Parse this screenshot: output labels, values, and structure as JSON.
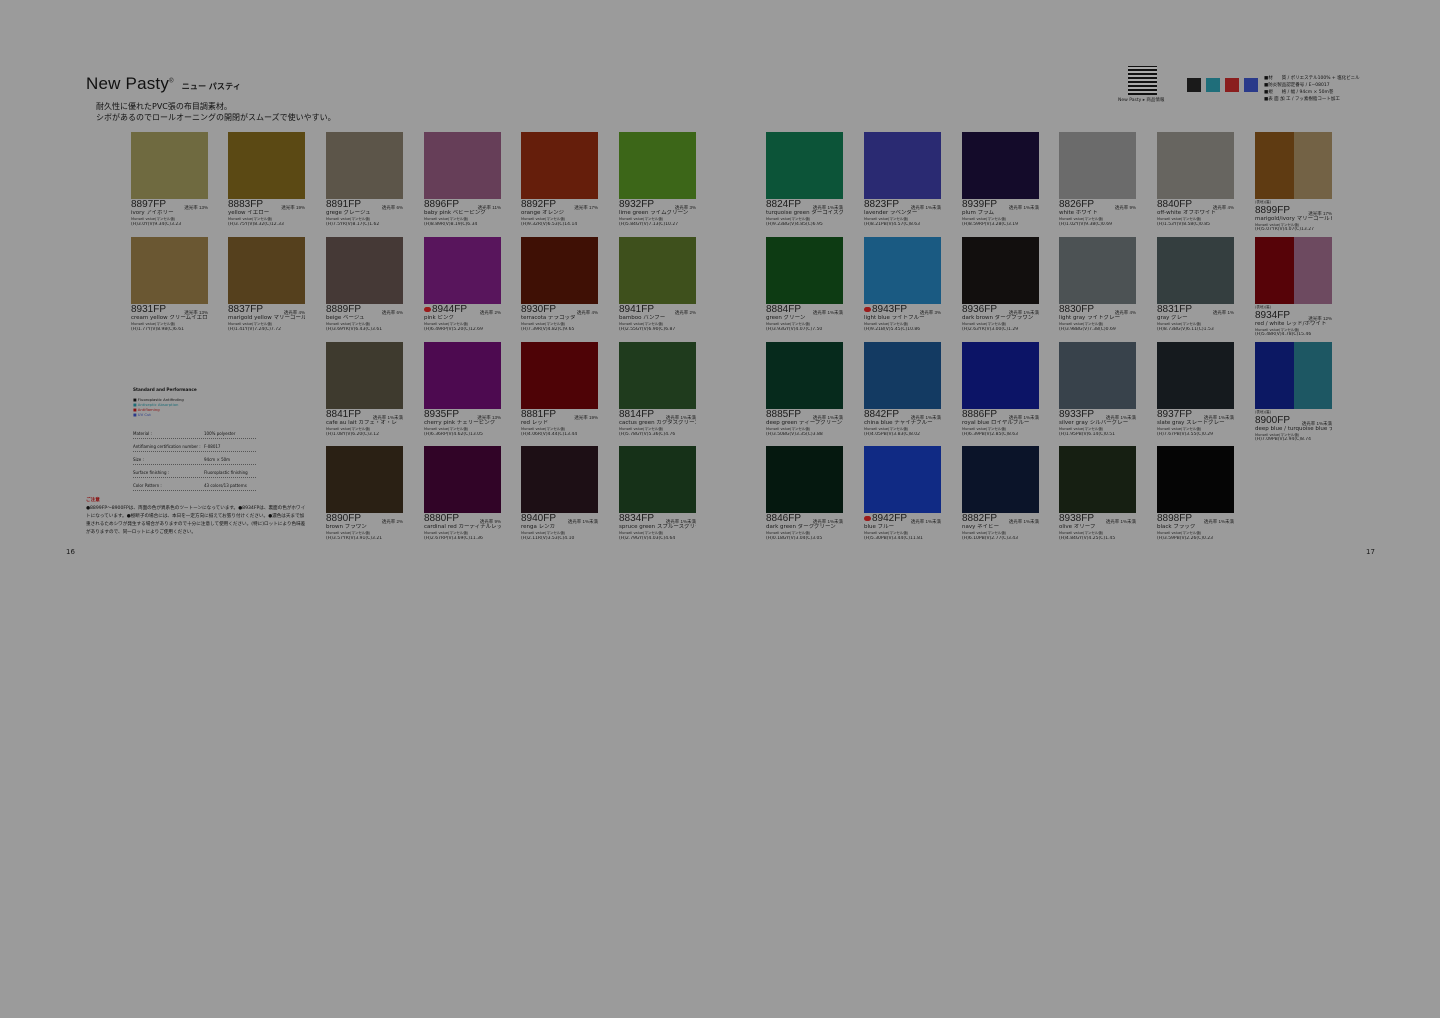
{
  "header": {
    "title": "New Pasty",
    "title_reg": "®",
    "title_ja": "ニュー パスティ",
    "tagline1": "耐久性に優れたPVC張の布目調素材。",
    "tagline2": "シボがあるのでロールオーニングの開閉がスムーズで使いやすい。"
  },
  "top_right": {
    "qr_label": "New Pasty ▸ 商品情報",
    "cert_colors": [
      "#1a1a1a",
      "#1f6e7a",
      "#8a1e1e",
      "#2a3a8a"
    ],
    "spec_lines": [
      "■材　　質 / ポリエステル100% + 塩化ビニル",
      "■防炎製品認定番号 / E−08017",
      "■規　　格 / 幅 / 94cm × 50m巻",
      "■表 面 加 工 / フッ素樹脂コート加工"
    ]
  },
  "page_numbers": {
    "left": "16",
    "right": "17"
  },
  "spec_box": {
    "title": "Standard and Performance",
    "legend": [
      "■ Fluoroplastic Antifinding",
      "■ Antiseptic Absorption",
      "■ Antiflaming",
      "■ UV Cut"
    ],
    "legend_colors": [
      "#111111",
      "#1e6e78",
      "#8b1010",
      "#2a3a8a"
    ],
    "rows": [
      {
        "k": "Material :",
        "v": "100% polyester"
      },
      {
        "k": "Antiflaming certification number :",
        "v": "F-08017"
      },
      {
        "k": "Size :",
        "v": "94cm × 50m"
      },
      {
        "k": "Surface finishing :",
        "v": "Fluoroplastic finishing"
      },
      {
        "k": "Color Pattern :",
        "v": "43 colors/13 patterns"
      }
    ]
  },
  "note": {
    "heading": "ご注意",
    "text": "●8899FP〜8900FPは、両面の色が異系色のツートーンになっています。●8934FPは、裏面の色がホワイトになっています。●極断子の場合には、本日を一定方向に揃えてお張り付けください。●濃色は天まで加重されるためシワが発生する場合がありますので十分に注意して使用ください。(特に)ロットにより色味差がありますので、同一ロットによりご使用ください。"
  },
  "mark_label": "Munsell value(マンセル値)",
  "swatches": [
    {
      "code": "8897FP",
      "rate": "透光率 13%",
      "name": "ivory",
      "ja": "アイボリー",
      "val": "(H)3.0Y(V)9.34(C)3.23",
      "color": "#6f6a40"
    },
    {
      "code": "8883FP",
      "rate": "透光率 19%",
      "name": "yellow",
      "ja": "イエロー",
      "val": "(H)3.75Y(V)8.32(C)12.33",
      "color": "#5b4914"
    },
    {
      "code": "8891FP",
      "rate": "透光率 6%",
      "name": "grege",
      "ja": "グレージュ",
      "val": "(H)7.5YR(V)8.17(C)1.62",
      "color": "#5c5549"
    },
    {
      "code": "8896FP",
      "rate": "透光率 11%",
      "name": "baby pink",
      "ja": "ベビーピンク",
      "val": "(H)8.89R(V)8.19(C)6.34",
      "color": "#663e58"
    },
    {
      "code": "8892FP",
      "rate": "透光率 17%",
      "name": "orange",
      "ja": "オレンジ",
      "val": "(H)9.32R(V)6.53(C)14.14",
      "color": "#651e0b"
    },
    {
      "code": "8932FP",
      "rate": "透光率 3%",
      "name": "lime green",
      "ja": "ライムグリーン",
      "val": "(H)5.84GY(V)7.13(C)10.27",
      "color": "#3c6618"
    },
    {
      "code": "8931FP",
      "rate": "透光率 13%",
      "name": "cream yellow",
      "ja": "クリームイエロー",
      "val": "(H)1.77Y(V)8.98(C)6.61",
      "color": "#6a5732"
    },
    {
      "code": "8837FP",
      "rate": "透光率 4%",
      "name": "marigold yellow",
      "ja": "マリーゴールドイエロー",
      "val": "(H)1.41Y(V)7.24(C)7.72",
      "color": "#55401d"
    },
    {
      "code": "8889FP",
      "rate": "透光率 6%",
      "name": "beige",
      "ja": "ベージュ",
      "val": "(H)3.69YR(V)6.43(C)3.61",
      "color": "#453936"
    },
    {
      "code": "8944FP",
      "rate": "透光率 2%",
      "name": "pink",
      "ja": "ピンク",
      "val": "(H)6.49RP(V)5.20(C)12.69",
      "color": "#58155c",
      "badge": true
    },
    {
      "code": "8930FP",
      "rate": "透光率 4%",
      "name": "terracota",
      "ja": "テラコッタ",
      "val": "(H)7.39R(V)4.82(C)9.65",
      "color": "#3f1005"
    },
    {
      "code": "8941FP",
      "rate": "透光率 2%",
      "name": "bamboo",
      "ja": "バンブー",
      "val": "(H)2.55GY(V)6.90(C)6.87",
      "color": "#3e501c"
    },
    {
      "code": "8841FP",
      "rate": "透光率 1%未満",
      "name": "cafe au lait",
      "ja": "カフェ・オ・レ",
      "val": "(H)1.08Y(V)6.20(C)3.12",
      "color": "#3e3a2e"
    },
    {
      "code": "8935FP",
      "rate": "透光率 13%",
      "name": "cherry pink",
      "ja": "チェリーピンク",
      "val": "(H)6.36RP(V)4.62(C)13.05",
      "color": "#4d0a50"
    },
    {
      "code": "8881FP",
      "rate": "透光率 19%",
      "name": "red",
      "ja": "レッド",
      "val": "(H)4.06R(V)4.44(C)13.44",
      "color": "#4e0306"
    },
    {
      "code": "8814FP",
      "rate": "透光率 1%未満",
      "name": "cactus green",
      "ja": "カクタスグリーン",
      "val": "(H)5.78GY(V)5.36(C)4.76",
      "color": "#1f3b1d"
    },
    {
      "code": "8890FP",
      "rate": "透光率 2%",
      "name": "brown",
      "ja": "ブラウン",
      "val": "(H)3.57YR(V)3.91(C)3.21",
      "color": "#2a2014"
    },
    {
      "code": "8880FP",
      "rate": "透光率 9%",
      "name": "cardinal red",
      "ja": "カーディナルレッド",
      "val": "(H)2.67RP(V)3.69(C)11.36",
      "color": "#310427"
    },
    {
      "code": "8940FP",
      "rate": "透光率 1%未満",
      "name": "renga",
      "ja": "レンガ",
      "val": "(H)2.11R(V)3.53(C)4.10",
      "color": "#1d0f15"
    },
    {
      "code": "8834FP",
      "rate": "透光率 1%未満",
      "name": "spruce green",
      "ja": "スプルースグリーン",
      "val": "(H)2.79GY(V)4.03(C)4.64",
      "color": "#163118"
    },
    {
      "code": "8824FP",
      "rate": "透光率 1%未満",
      "name": "turquoise green",
      "ja": "ターコイズグリーン",
      "val": "(H)9.23BG(V)4.85(C)6.95",
      "color": "#0c5438"
    },
    {
      "code": "8823FP",
      "rate": "透光率 1%未満",
      "name": "lavender",
      "ja": "ラベンダー",
      "val": "(H)8.21PB(V)4.57(C)8.63",
      "color": "#2a2a72"
    },
    {
      "code": "8939FP",
      "rate": "透光率 1%未満",
      "name": "plum",
      "ja": "プラム",
      "val": "(H)8.59RP(V)3.28(C)3.19",
      "color": "#140b2a"
    },
    {
      "code": "8826FP",
      "rate": "透光率 9%",
      "name": "white",
      "ja": "ホワイト",
      "val": "(H)1.02Y(V)9.38(C)0.69",
      "color": "#6b6b6b"
    },
    {
      "code": "8840FP",
      "rate": "透光率 4%",
      "name": "off-white",
      "ja": "オフホワイト",
      "val": "(H)1.53Y(V)8.58(C)0.85",
      "color": "#676560"
    },
    {
      "code": "8899FP",
      "rate": "透光率 17%",
      "name": "marigold/ivory",
      "ja": "マリーゴールド/アイボリー",
      "val": "(H)5.07YR(V)4.07(C)13.27",
      "colors": [
        "#5f3b12",
        "#736245"
      ],
      "pre": "(表地)(裏)"
    },
    {
      "code": "8884FP",
      "rate": "透光率 1%未満",
      "name": "green",
      "ja": "グリーン",
      "val": "(H)3.93GY(V)4.07(C)7.50",
      "color": "#0d3b13"
    },
    {
      "code": "8943FP",
      "rate": "透光率 3%",
      "name": "light blue",
      "ja": "ライトブルー",
      "val": "(H)9.21B(V)5.45(C)10.86",
      "color": "#1a5a82",
      "badge": true
    },
    {
      "code": "8936FP",
      "rate": "透光率 1%未満",
      "name": "dark brown",
      "ja": "ダークブラウン",
      "val": "(H)2.63YR(V)3.00(C)1.29",
      "color": "#120f0e"
    },
    {
      "code": "8830FP",
      "rate": "透光率 4%",
      "name": "light gray",
      "ja": "ライトグレー",
      "val": "(H)3.98BG(V)7.38(C)0.69",
      "color": "#4c5254"
    },
    {
      "code": "8831FP",
      "rate": "透光率 1%",
      "name": "gray",
      "ja": "グレー",
      "val": "(H)8.73BG(V)6.11(C)1.53",
      "color": "#343e3f"
    },
    {
      "code": "8934FP",
      "rate": "透光率 12%",
      "name": "red / white",
      "ja": "レッド/ホワイト",
      "val": "(H)5.48R(V)4.78(C)15.46",
      "colors": [
        "#560308",
        "#6d4a60"
      ],
      "pre": "(表地)(裏)"
    },
    {
      "code": "8885FP",
      "rate": "透光率 1%未満",
      "name": "deep green",
      "ja": "ディープグリーン",
      "val": "(H)3.50BG(V)3.35(C)3.88",
      "color": "#062a1c"
    },
    {
      "code": "8842FP",
      "rate": "透光率 1%未満",
      "name": "china blue",
      "ja": "チャイナブルー",
      "val": "(H)4.05PB(V)3.83(C)8.02",
      "color": "#133a62"
    },
    {
      "code": "8886FP",
      "rate": "透光率 1%未満",
      "name": "royal blue",
      "ja": "ロイヤルブルー",
      "val": "(H)6.39PB(V)2.85(C)8.63",
      "color": "#0c1466"
    },
    {
      "code": "8933FP",
      "rate": "透光率 1%未満",
      "name": "silver gray",
      "ja": "シルバーグレー",
      "val": "(H)1.95PB(V)6.14(C)0.51",
      "color": "#38424b"
    },
    {
      "code": "8937FP",
      "rate": "透光率 1%未満",
      "name": "slate gray",
      "ja": "スレートグレー",
      "val": "(H)7.67PB(V)3.55(C)0.29",
      "color": "#151a1e"
    },
    {
      "code": "8900FP",
      "rate": "透光率 1%未満",
      "name": "deep blue / turquoise blue",
      "ja": "ディープブルー/ターコイズブルー",
      "val": "(H)7.09PB(V)2.94(C)8.74",
      "colors": [
        "#0c1863",
        "#1d5763"
      ],
      "pre": "(表地)(裏)"
    },
    {
      "code": "8846FP",
      "rate": "透光率 1%未満",
      "name": "dark green",
      "ja": "ダークグリーン",
      "val": "(H)0.18GY(V)3.04(C)3.05",
      "color": "#05180f"
    },
    {
      "code": "8942FP",
      "rate": "透光率 1%未満",
      "name": "blue",
      "ja": "ブルー",
      "val": "(H)5.30PB(V)3.44(C)11.81",
      "color": "#102a84",
      "badge": true
    },
    {
      "code": "8882FP",
      "rate": "透光率 1%未満",
      "name": "navy",
      "ja": "ネイビー",
      "val": "(H)6.10PB(V)2.77(C)3.43",
      "color": "#0b1429"
    },
    {
      "code": "8938FP",
      "rate": "透光率 1%未満",
      "name": "olive",
      "ja": "オリーブ",
      "val": "(H)4.84GY(V)4.25(C)1.45",
      "color": "#161f12"
    },
    {
      "code": "8898FP",
      "rate": "透光率 1%未満",
      "name": "black",
      "ja": "ブラック",
      "val": "(H)3.59PB(V)2.26(C)0.23",
      "color": "#050505"
    }
  ]
}
